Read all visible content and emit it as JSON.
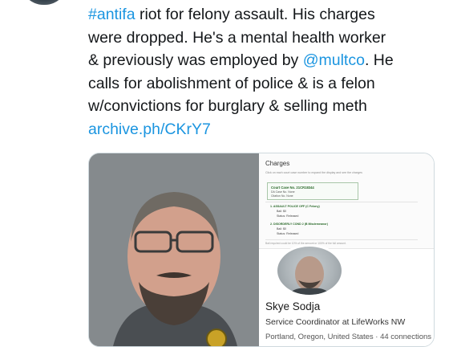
{
  "tweet": {
    "lines": [
      {
        "hashtag": "#antifa",
        "rest": " riot for felony assault. His charges"
      },
      {
        "text": "were dropped. He's a mental health worker"
      },
      {
        "pre": "& previously was employed by ",
        "mention": "@multco",
        "post": ". He"
      },
      {
        "text": "calls for abolishment of police & is a felon"
      },
      {
        "text": "w/convictions for burglary & selling meth"
      },
      {
        "link": "archive.ph/CKrY7"
      }
    ]
  },
  "record": {
    "title": "Charges",
    "hint": "Click on each court case number to expand the display and see the charges",
    "case": {
      "number": "Court Case No. 21CR18344",
      "da_case": "DA Case No. None",
      "citation": "Citation No. None"
    },
    "charges": [
      {
        "title": "1.  ASSAULT POLICE OFF (C Felony)",
        "bail": "Bail: $0",
        "status": "Status: Released"
      },
      {
        "title": "2.  DISORDERLY COND 2 (B Misdemeanor)",
        "bail": "Bail: $0",
        "status": "Status: Released"
      }
    ],
    "footnote": "Bail required could be 10% of the amount or 100% of the full amount."
  },
  "profile": {
    "name": "Skye Sodja",
    "role": "Service Coordinator at LifeWorks NW",
    "location": "Portland, Oregon, United States · 44 connections"
  },
  "colors": {
    "link": "#1b95e0",
    "text": "#14171a",
    "charge_green": "#2a6a2a"
  },
  "icons": [
    "avatar",
    "sheriff-badge-icon"
  ]
}
